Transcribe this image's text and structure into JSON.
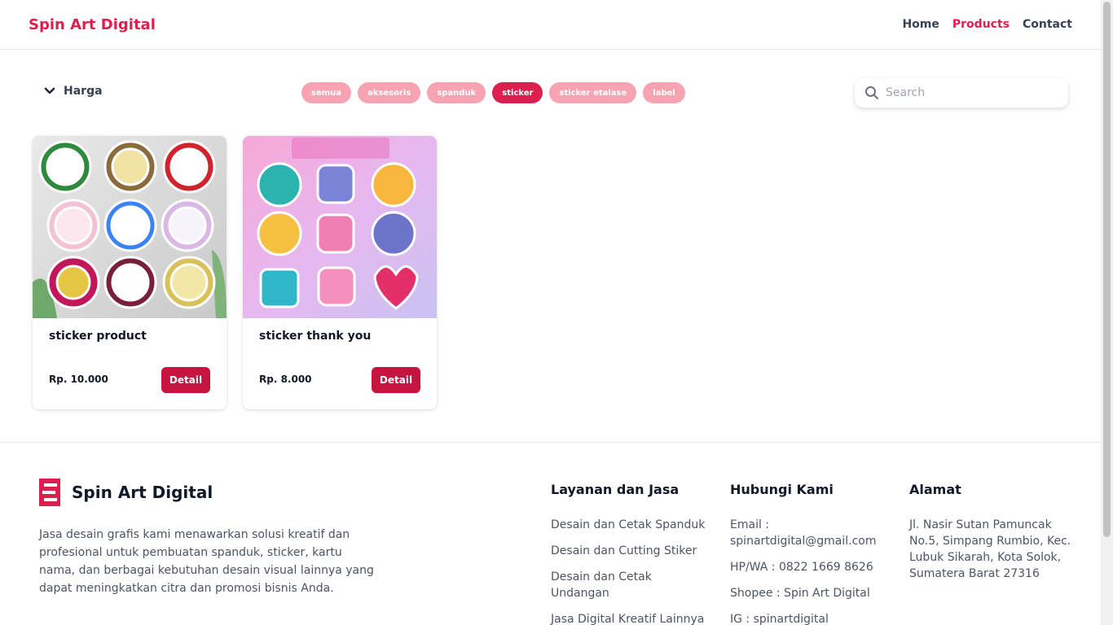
{
  "header": {
    "brand": "Spin Art Digital",
    "nav": [
      "Home",
      "Products",
      "Contact"
    ],
    "active_nav": "Products",
    "accent_color": "#dc1f4e"
  },
  "filters": {
    "price_label": "Harga",
    "categories": [
      "semua",
      "aksesoris",
      "spanduk",
      "sticker",
      "sticker etalase",
      "label"
    ],
    "active_category": "sticker",
    "search_placeholder": "Search"
  },
  "products": [
    {
      "title": "sticker product",
      "price": "Rp. 10.000",
      "button": "Detail"
    },
    {
      "title": "sticker thank you",
      "price": "Rp. 8.000",
      "button": "Detail"
    }
  ],
  "footer": {
    "brand": "Spin Art Digital",
    "description": "Jasa desain grafis kami menawarkan solusi kreatif dan profesional untuk pembuatan spanduk, sticker, kartu nama, dan berbagai kebutuhan desain visual lainnya yang dapat meningkatkan citra dan promosi bisnis Anda.",
    "services_title": "Layanan dan Jasa",
    "services": [
      "Desain dan Cetak Spanduk",
      "Desain dan Cutting Stiker",
      "Desain dan Cetak Undangan",
      "Jasa Digital Kreatif Lainnya"
    ],
    "contact_title": "Hubungi Kami",
    "contacts": [
      "Email : spinartdigital@gmail.com",
      "HP/WA : 0822 1669 8626",
      "Shopee : Spin Art Digital",
      "IG : spinartdigital"
    ],
    "address_title": "Alamat",
    "address": "Jl. Nasir Sutan Pamuncak No.5, Simpang Rumbio, Kec. Lubuk Sikarah, Kota Solok, Sumatera Barat 27316"
  }
}
